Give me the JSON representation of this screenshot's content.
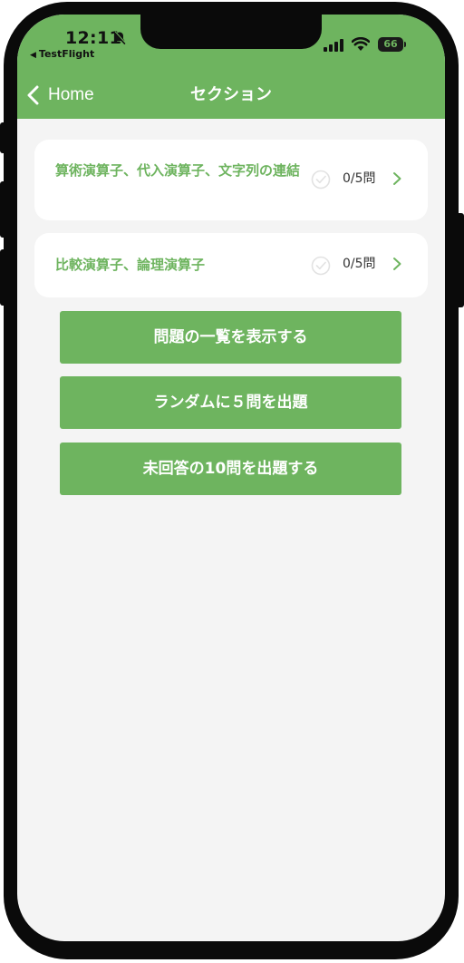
{
  "status_bar": {
    "time": "12:11",
    "back_app": "TestFlight",
    "battery": "66",
    "battery_level": 0.66,
    "icons": [
      "bell-slash-icon",
      "signal-icon",
      "wifi-icon",
      "battery-icon"
    ]
  },
  "nav": {
    "back_label": "Home",
    "title": "セクション"
  },
  "sections": [
    {
      "title": "算術演算子、代入演算子、文字列の連結",
      "count": "0/5問"
    },
    {
      "title": "比較演算子、論理演算子",
      "count": "0/5問"
    }
  ],
  "actions": {
    "list": "問題の一覧を表示する",
    "random": "ランダムに５問を出題",
    "unanswered": "未回答の10問を出題する"
  },
  "colors": {
    "accent": "#6eb45f",
    "background": "#f4f4f4",
    "card": "#ffffff"
  }
}
